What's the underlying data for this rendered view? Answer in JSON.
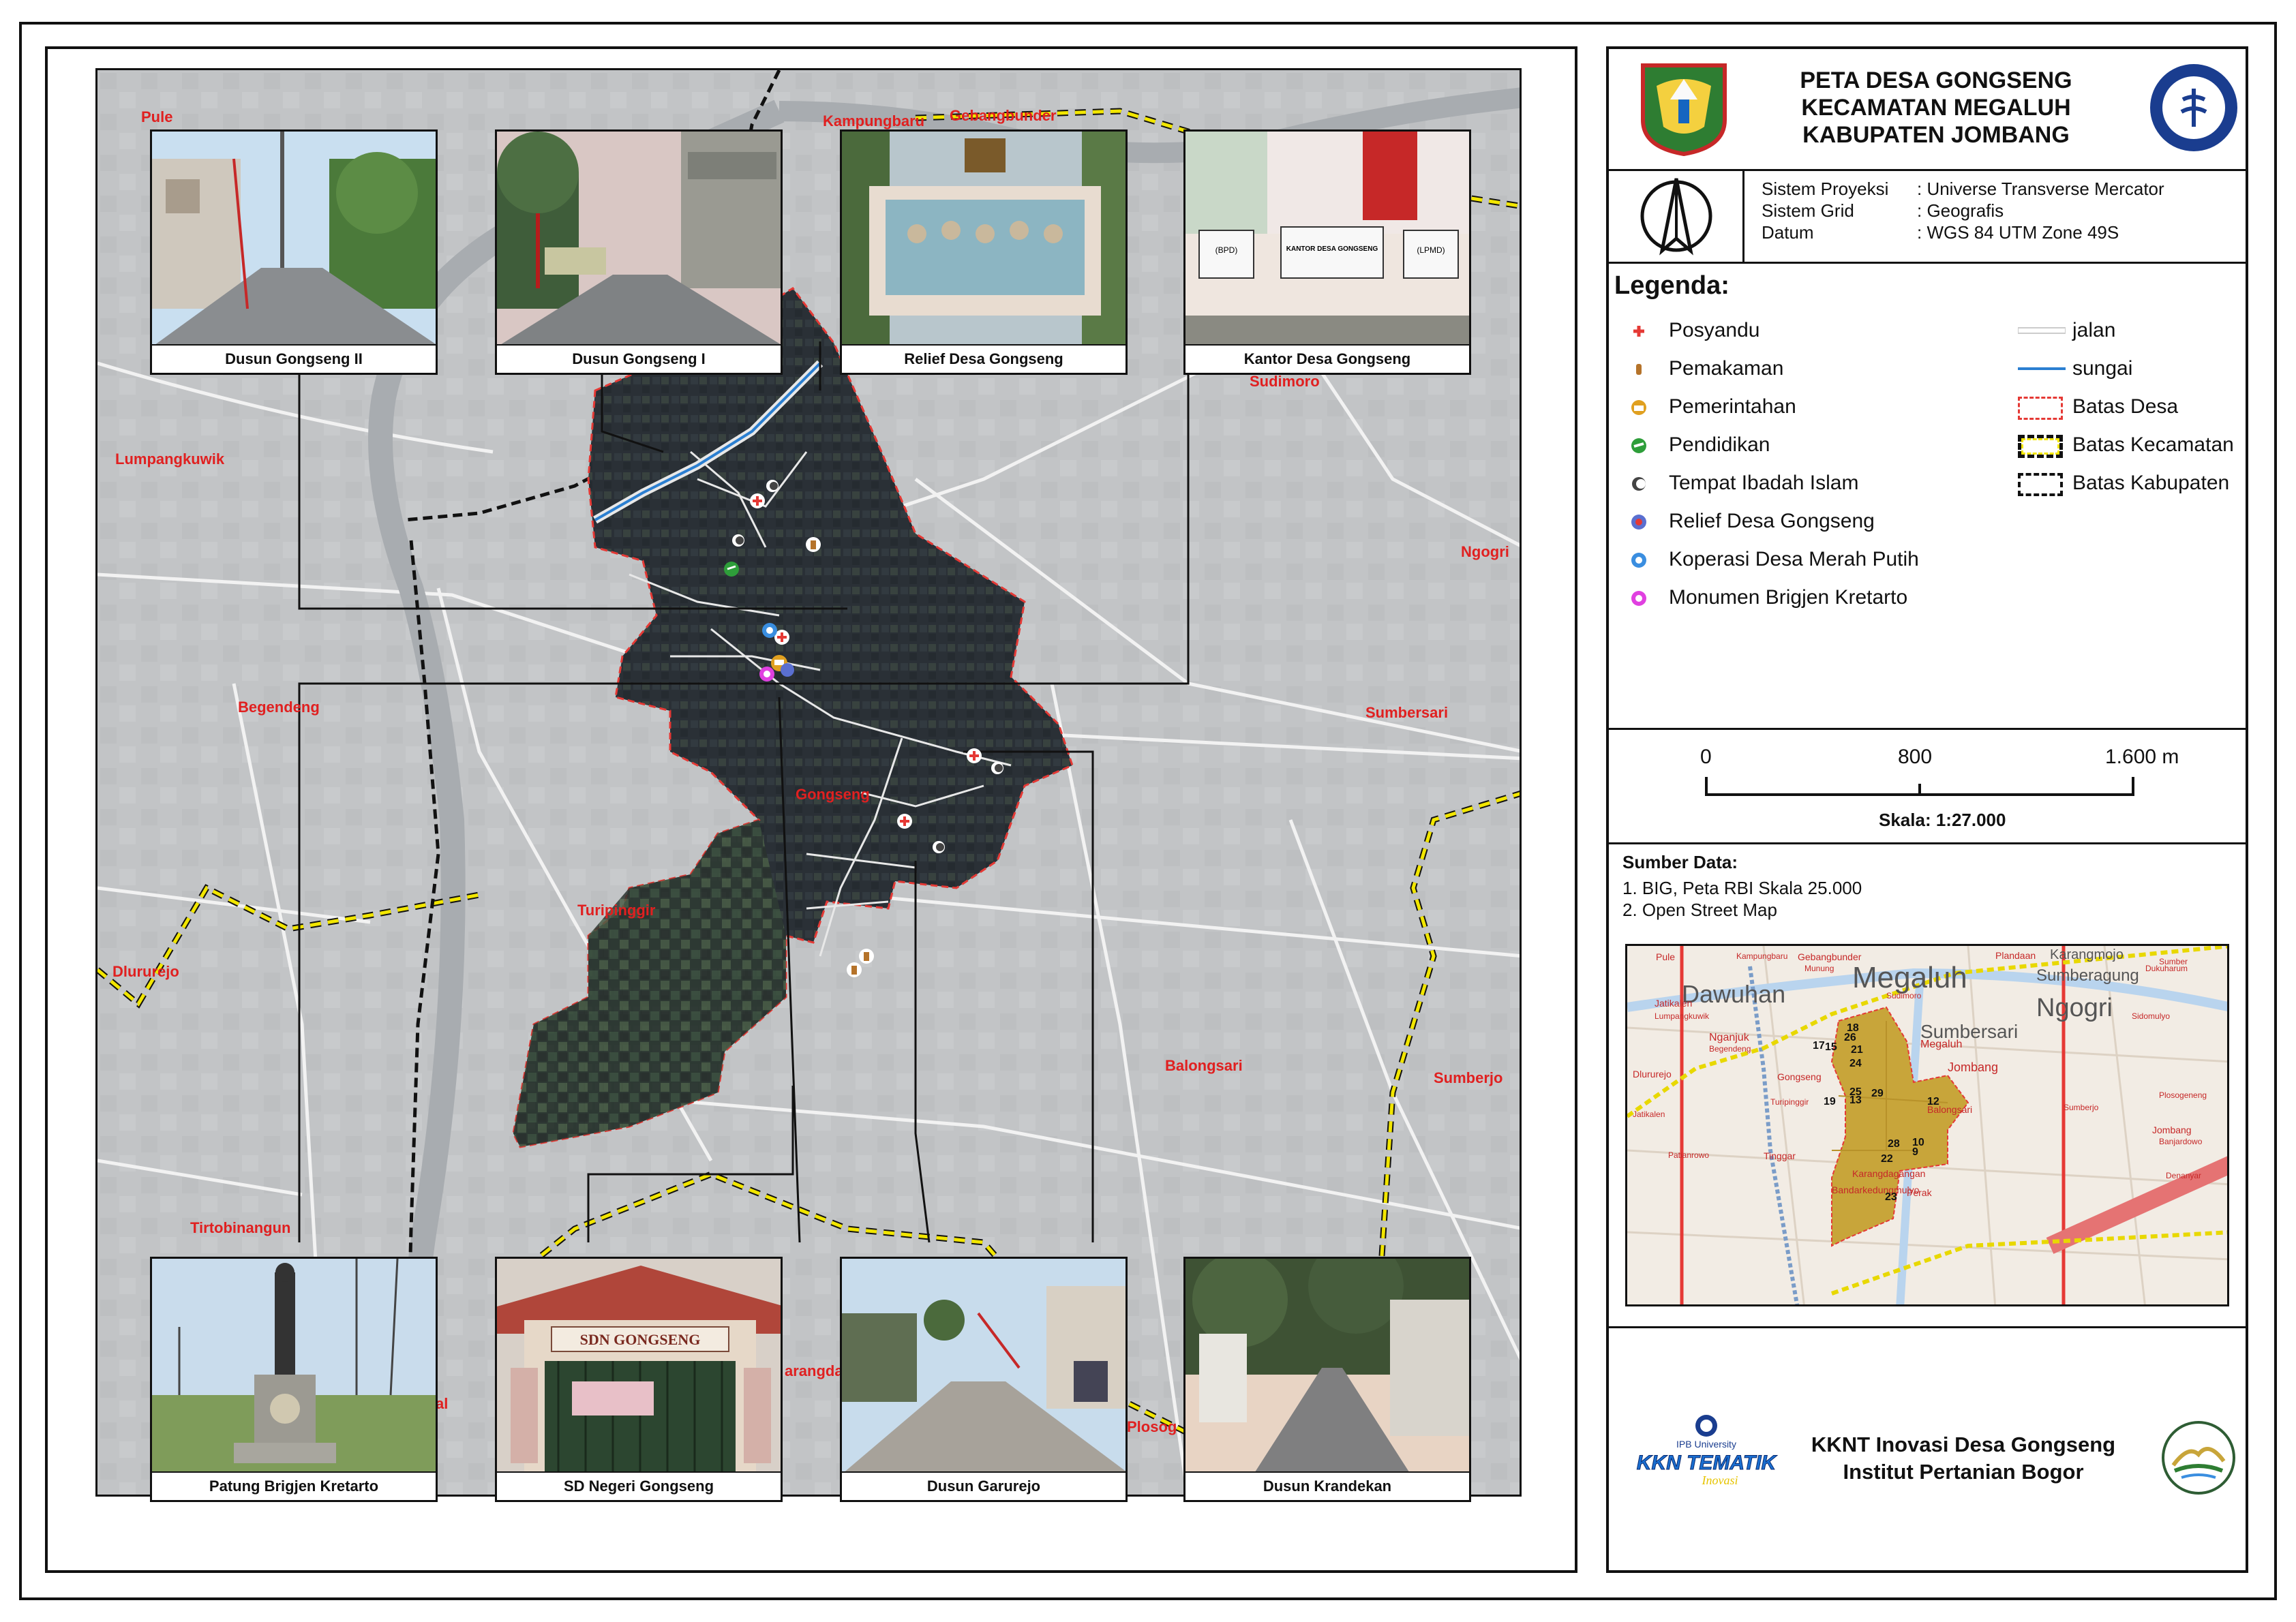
{
  "title": {
    "line1": "PETA DESA GONGSENG",
    "line2": "KECAMATAN MEGALUH",
    "line3": "KABUPATEN JOMBANG"
  },
  "projection": {
    "rows": [
      {
        "label": "Sistem Proyeksi",
        "value": ": Universe Transverse Mercator"
      },
      {
        "label": "Sistem Grid",
        "value": ": Geografis"
      },
      {
        "label": "Datum",
        "value": ": WGS 84 UTM Zone 49S"
      }
    ]
  },
  "legend": {
    "title": "Legenda:",
    "points": [
      {
        "label": "Posyandu",
        "icon": "posyandu-icon",
        "color": "#e53935"
      },
      {
        "label": "Pemakaman",
        "icon": "pemakaman-icon",
        "color": "#b5732a"
      },
      {
        "label": "Pemerintahan",
        "icon": "pemerintahan-icon",
        "color": "#e0a020"
      },
      {
        "label": "Pendidikan",
        "icon": "pendidikan-icon",
        "color": "#2e9e3a"
      },
      {
        "label": "Tempat Ibadah Islam",
        "icon": "mosque-icon",
        "color": "#444444"
      },
      {
        "label": "Relief Desa Gongseng",
        "icon": "relief-icon",
        "color": "#5a6fd0"
      },
      {
        "label": "Koperasi Desa Merah Putih",
        "icon": "koperasi-icon",
        "color": "#3a8ee0"
      },
      {
        "label": "Monumen Brigjen Kretarto",
        "icon": "monumen-icon",
        "color": "#e040e0"
      }
    ],
    "lines": [
      {
        "label": "jalan",
        "icon": "road-line-icon",
        "color": "#dddddd"
      },
      {
        "label": "sungai",
        "icon": "river-line-icon",
        "color": "#2b7fd1"
      },
      {
        "label": "Batas Desa",
        "icon": "village-boundary-icon",
        "color": "#e53935"
      },
      {
        "label": "Batas Kecamatan",
        "icon": "district-boundary-icon",
        "color": "#f2e600"
      },
      {
        "label": "Batas Kabupaten",
        "icon": "regency-boundary-icon",
        "color": "#111111"
      }
    ]
  },
  "scale": {
    "tick0": "0",
    "tick1": "800",
    "tick2": "1.600 m",
    "label": "Skala:  1:27.000"
  },
  "sources": {
    "title": "Sumber Data:",
    "items": [
      "1. BIG, Peta RBI Skala 25.000",
      "2. Open Street Map"
    ]
  },
  "footer": {
    "line1": "KKNT Inovasi Desa Gongseng",
    "line2": "Institut Pertanian Bogor",
    "logo_text_small": "IPB University",
    "logo_text_big": "KKN TEMATIK",
    "logo_text_script": "Inovasi"
  },
  "map_labels": [
    {
      "id": "pule",
      "text": "Pule"
    },
    {
      "id": "kampungbaru",
      "text": "Kampungbaru"
    },
    {
      "id": "gebangbunder",
      "text": "Gebangbunder"
    },
    {
      "id": "sudimoro",
      "text": "Sudimoro"
    },
    {
      "id": "lumpangkuwik",
      "text": "Lumpangkuwik"
    },
    {
      "id": "ngogri",
      "text": "Ngogri"
    },
    {
      "id": "begendeng",
      "text": "Begendeng"
    },
    {
      "id": "sumbersari",
      "text": "Sumbersari"
    },
    {
      "id": "gongseng",
      "text": "Gongseng"
    },
    {
      "id": "turipinggir",
      "text": "Turipinggir"
    },
    {
      "id": "dlururejo",
      "text": "Dlururejo"
    },
    {
      "id": "balongsari",
      "text": "Balongsari"
    },
    {
      "id": "sumberjo",
      "text": "Sumberjo"
    },
    {
      "id": "tirtobinangun",
      "text": "Tirtobinangun"
    },
    {
      "id": "plosog",
      "text": "Plosog"
    },
    {
      "id": "karangdagangan",
      "text": "arangda"
    },
    {
      "id": "al",
      "text": "al"
    }
  ],
  "photos_top": [
    {
      "caption": "Dusun Gongseng II"
    },
    {
      "caption": "Dusun Gongseng I"
    },
    {
      "caption": "Relief Desa Gongseng"
    },
    {
      "caption": "Kantor Desa Gongseng"
    }
  ],
  "photos_bottom": [
    {
      "caption": "Patung Brigjen Kretarto"
    },
    {
      "caption": "SD Negeri Gongseng"
    },
    {
      "caption": "Dusun Garurejo"
    },
    {
      "caption": "Dusun Krandekan"
    }
  ],
  "photo_texts": {
    "sd_sign": "SDN GONGSENG",
    "kantor_sign": "KANTOR DESA GONGSENG",
    "bpd": "(BPD)",
    "lpmd": "(LPMD)"
  },
  "inset": {
    "labels": [
      {
        "text": "Pule"
      },
      {
        "text": "Kampungbaru"
      },
      {
        "text": "Gebangbunder"
      },
      {
        "text": "Plandaan"
      },
      {
        "text": "Karangmojo"
      },
      {
        "text": "Megaluh"
      },
      {
        "text": "Dawuhan"
      },
      {
        "text": "Sumberagung"
      },
      {
        "text": "Ngogri"
      },
      {
        "text": "Jatikalen"
      },
      {
        "text": "Lumpangkuwik"
      },
      {
        "text": "Nganjuk"
      },
      {
        "text": "Begendeng"
      },
      {
        "text": "Megaluh"
      },
      {
        "text": "Sumbersari"
      },
      {
        "text": "Jombang"
      },
      {
        "text": "Gongseng"
      },
      {
        "text": "Turipinggir"
      },
      {
        "text": "Balongsari"
      },
      {
        "text": "Dlururejo"
      },
      {
        "text": "Jatikalen"
      },
      {
        "text": "Patianrowo"
      },
      {
        "text": "Tinggar"
      },
      {
        "text": "Karangdagangan"
      },
      {
        "text": "Bandarkedungmulyo"
      },
      {
        "text": "Perak"
      },
      {
        "text": "Sidomulyo"
      },
      {
        "text": "Plosogeneng"
      },
      {
        "text": "Jombang"
      },
      {
        "text": "Banjardowo"
      },
      {
        "text": "Denanyar"
      },
      {
        "text": "Sumberjo"
      },
      {
        "text": "Sudimoro"
      },
      {
        "text": "Munung"
      },
      {
        "text": "Dukuharum"
      },
      {
        "text": "Sumber"
      }
    ],
    "numbers": [
      "18",
      "26",
      "17",
      "15",
      "21",
      "24",
      "25",
      "13",
      "29",
      "19",
      "12",
      "28",
      "22",
      "10",
      "9",
      "23"
    ],
    "colors": {
      "village_fill": "#c8a53a",
      "boundary_red": "#e53935",
      "boundary_yellow": "#e8d800"
    }
  },
  "colors": {
    "village_area": "#2a3036",
    "background_map": "#c4c6c8",
    "place_label": "#e02020"
  }
}
